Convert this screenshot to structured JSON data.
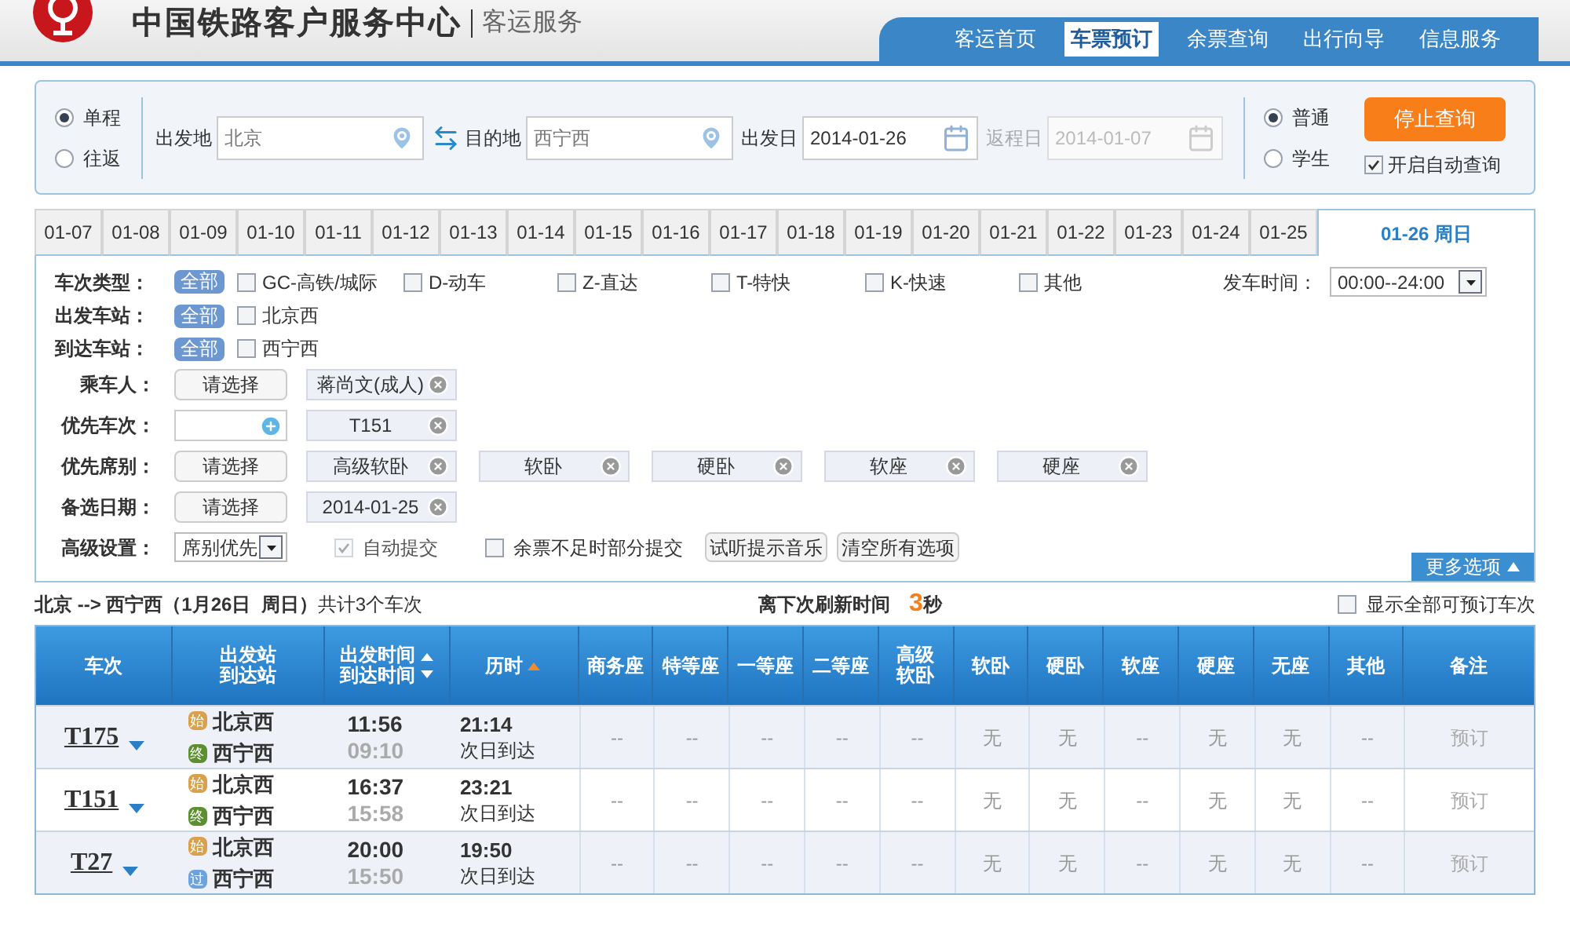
{
  "header": {
    "title": "中国铁路客户服务中心",
    "subtitle": "客运服务",
    "nav": [
      {
        "label": "客运首页",
        "selected": false
      },
      {
        "label": "车票预订",
        "selected": true
      },
      {
        "label": "余票查询",
        "selected": false
      },
      {
        "label": "出行向导",
        "selected": false
      },
      {
        "label": "信息服务",
        "selected": false
      }
    ]
  },
  "search": {
    "trip_types": [
      {
        "label": "单程",
        "selected": true
      },
      {
        "label": "往返",
        "selected": false
      }
    ],
    "from": {
      "label": "出发地",
      "value": "北京"
    },
    "to": {
      "label": "目的地",
      "value": "西宁西"
    },
    "depart": {
      "label": "出发日",
      "value": "2014-01-26",
      "disabled": false
    },
    "return": {
      "label": "返程日",
      "value": "2014-01-07",
      "disabled": true
    },
    "ticket_types": [
      {
        "label": "普通",
        "selected": true
      },
      {
        "label": "学生",
        "selected": false
      }
    ],
    "stop_button": "停止查询",
    "auto_query": {
      "label": "开启自动查询",
      "checked": true
    }
  },
  "dates": [
    {
      "label": "01-07",
      "selected": false
    },
    {
      "label": "01-08",
      "selected": false
    },
    {
      "label": "01-09",
      "selected": false
    },
    {
      "label": "01-10",
      "selected": false
    },
    {
      "label": "01-11",
      "selected": false
    },
    {
      "label": "01-12",
      "selected": false
    },
    {
      "label": "01-13",
      "selected": false
    },
    {
      "label": "01-14",
      "selected": false
    },
    {
      "label": "01-15",
      "selected": false
    },
    {
      "label": "01-16",
      "selected": false
    },
    {
      "label": "01-17",
      "selected": false
    },
    {
      "label": "01-18",
      "selected": false
    },
    {
      "label": "01-19",
      "selected": false
    },
    {
      "label": "01-20",
      "selected": false
    },
    {
      "label": "01-21",
      "selected": false
    },
    {
      "label": "01-22",
      "selected": false
    },
    {
      "label": "01-23",
      "selected": false
    },
    {
      "label": "01-24",
      "selected": false
    },
    {
      "label": "01-25",
      "selected": false
    },
    {
      "label": "01-26 周日",
      "selected": true
    }
  ],
  "filters": {
    "train_types": {
      "label": "车次类型：",
      "all": {
        "label": "全部",
        "selected": true
      },
      "options": [
        {
          "label": "GC-高铁/城际",
          "checked": false
        },
        {
          "label": "D-动车",
          "checked": false
        },
        {
          "label": "Z-直达",
          "checked": false
        },
        {
          "label": "T-特快",
          "checked": false
        },
        {
          "label": "K-快速",
          "checked": false
        },
        {
          "label": "其他",
          "checked": false
        }
      ]
    },
    "depart_time": {
      "label": "发车时间：",
      "value": "00:00--24:00"
    },
    "depart_station": {
      "label": "出发车站：",
      "all": {
        "label": "全部",
        "selected": true
      },
      "options": [
        {
          "label": "北京西",
          "checked": false
        }
      ]
    },
    "arrive_station": {
      "label": "到达车站：",
      "all": {
        "label": "全部",
        "selected": true
      },
      "options": [
        {
          "label": "西宁西",
          "checked": false
        }
      ]
    },
    "passenger": {
      "label": "乘车人：",
      "button": "请选择",
      "tags": [
        "蒋尚文(成人)"
      ]
    },
    "priority_train": {
      "label": "优先车次：",
      "tags": [
        "T151"
      ]
    },
    "priority_seat": {
      "label": "优先席别：",
      "button": "请选择",
      "tags": [
        "高级软卧",
        "软卧",
        "硬卧",
        "软座",
        "硬座"
      ]
    },
    "backup_date": {
      "label": "备选日期：",
      "button": "请选择",
      "tags": [
        "2014-01-25"
      ]
    },
    "advanced": {
      "label": "高级设置：",
      "select": "席别优先",
      "auto_submit": {
        "label": "自动提交",
        "checked": true,
        "disabled": true
      },
      "partial_submit": {
        "label": "余票不足时部分提交",
        "checked": false,
        "disabled": false
      },
      "buttons": [
        "试听提示音乐",
        "清空所有选项"
      ]
    },
    "more_options": "更多选项"
  },
  "summary": {
    "route": "北京 --> 西宁西（1月26日  周日）",
    "count": "共计3个车次",
    "refresh_label": "离下次刷新时间",
    "refresh_value": "3",
    "refresh_unit": "秒",
    "show_all": {
      "label": "显示全部可预订车次",
      "checked": false
    }
  },
  "table": {
    "columns": [
      {
        "lines": [
          "车次"
        ]
      },
      {
        "lines": [
          "出发站",
          "到达站"
        ]
      },
      {
        "lines": [
          "出发时间",
          "到达时间"
        ],
        "sort_up": true,
        "sort_down": true,
        "sort_active": false
      },
      {
        "lines": [
          "历时"
        ],
        "sort_up": true,
        "sort_down": false,
        "sort_active": true
      },
      {
        "lines": [
          "商务座"
        ]
      },
      {
        "lines": [
          "特等座"
        ]
      },
      {
        "lines": [
          "一等座"
        ]
      },
      {
        "lines": [
          "二等座"
        ]
      },
      {
        "lines": [
          "高级",
          "软卧"
        ]
      },
      {
        "lines": [
          "软卧"
        ]
      },
      {
        "lines": [
          "硬卧"
        ]
      },
      {
        "lines": [
          "软座"
        ]
      },
      {
        "lines": [
          "硬座"
        ]
      },
      {
        "lines": [
          "无座"
        ]
      },
      {
        "lines": [
          "其他"
        ]
      },
      {
        "lines": [
          "备注"
        ]
      }
    ],
    "rows": [
      {
        "train": "T175",
        "from_badge": {
          "text": "始",
          "kind": "start"
        },
        "from_station": "北京西",
        "to_badge": {
          "text": "终",
          "kind": "end"
        },
        "to_station": "西宁西",
        "depart": "11:56",
        "arrive": "09:10",
        "duration": "21:14",
        "duration_note": "次日到达",
        "seats": [
          "--",
          "--",
          "--",
          "--",
          "--",
          "无",
          "无",
          "--",
          "无",
          "无",
          "--"
        ],
        "action": "预订"
      },
      {
        "train": "T151",
        "from_badge": {
          "text": "始",
          "kind": "start"
        },
        "from_station": "北京西",
        "to_badge": {
          "text": "终",
          "kind": "end"
        },
        "to_station": "西宁西",
        "depart": "16:37",
        "arrive": "15:58",
        "duration": "23:21",
        "duration_note": "次日到达",
        "seats": [
          "--",
          "--",
          "--",
          "--",
          "--",
          "无",
          "无",
          "--",
          "无",
          "无",
          "--"
        ],
        "action": "预订"
      },
      {
        "train": "T27",
        "from_badge": {
          "text": "始",
          "kind": "start"
        },
        "from_station": "北京西",
        "to_badge": {
          "text": "过",
          "kind": "pass"
        },
        "to_station": "西宁西",
        "depart": "20:00",
        "arrive": "15:50",
        "duration": "19:50",
        "duration_note": "次日到达",
        "seats": [
          "--",
          "--",
          "--",
          "--",
          "--",
          "无",
          "无",
          "--",
          "无",
          "无",
          "--"
        ],
        "action": "预订"
      }
    ]
  }
}
